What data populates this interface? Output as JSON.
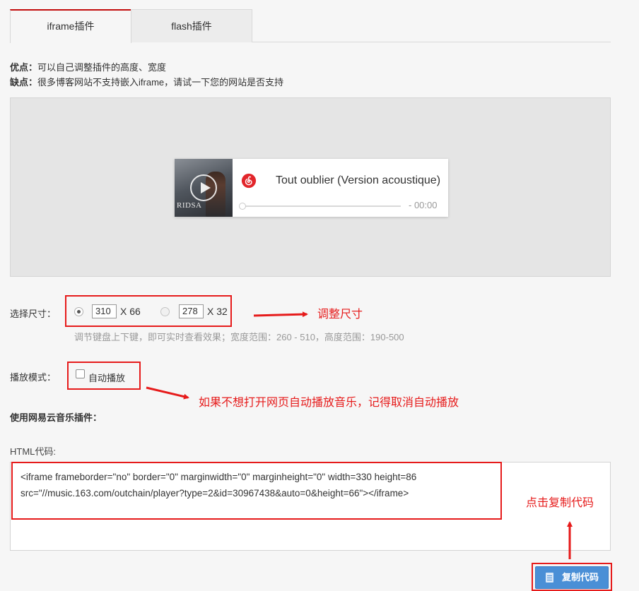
{
  "tabs": [
    {
      "label": "iframe插件",
      "active": true
    },
    {
      "label": "flash插件",
      "active": false
    }
  ],
  "info": {
    "pros_label": "优点：",
    "pros_text": "可以自己调整插件的高度、宽度",
    "cons_label": "缺点：",
    "cons_text": "很多博客网站不支持嵌入iframe，请试一下您的网站是否支持"
  },
  "player": {
    "cover_text": "RIDSA",
    "song_title": "Tout oublier (Version acoustique)",
    "time": "- 00:00"
  },
  "size": {
    "label": "选择尺寸：",
    "option1": {
      "width": "310",
      "x_height": "X 66",
      "selected": true
    },
    "option2": {
      "width": "278",
      "x_height": "X 32",
      "selected": false
    },
    "hint": "调节键盘上下键，即可实时查看效果；宽度范围：260 - 510，高度范围：190-500",
    "annotation": "调整尺寸"
  },
  "mode": {
    "label": "播放模式：",
    "autoplay_label": "自动播放",
    "autoplay_checked": false,
    "annotation": "如果不想打开网页自动播放音乐，记得取消自动播放"
  },
  "plugin": {
    "title": "使用网易云音乐插件：",
    "html_label": "HTML代码:",
    "code_line1": "<iframe frameborder=\"no\" border=\"0\" marginwidth=\"0\" marginheight=\"0\" width=330 height=86",
    "code_line2": "src=\"//music.163.com/outchain/player?type=2&id=30967438&auto=0&height=66\"></iframe>",
    "annotation": "点击复制代码"
  },
  "copy_button": {
    "label": "复制代码"
  },
  "colors": {
    "accent_red": "#e61b1b",
    "brand_red": "#c20c0c",
    "button_blue": "#4a8fd6"
  }
}
